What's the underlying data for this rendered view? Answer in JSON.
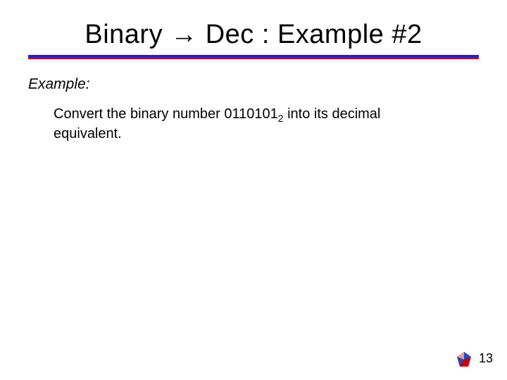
{
  "title": "Binary → Dec : Example #2",
  "example_label": "Example:",
  "body": {
    "prefix": "Convert the binary number ",
    "number": "0110101",
    "subscript": "2",
    "suffix": " into its decimal equivalent."
  },
  "page_number": "13",
  "colors": {
    "rule_top": "#1a1aff",
    "rule_bottom": "#cc0000"
  }
}
